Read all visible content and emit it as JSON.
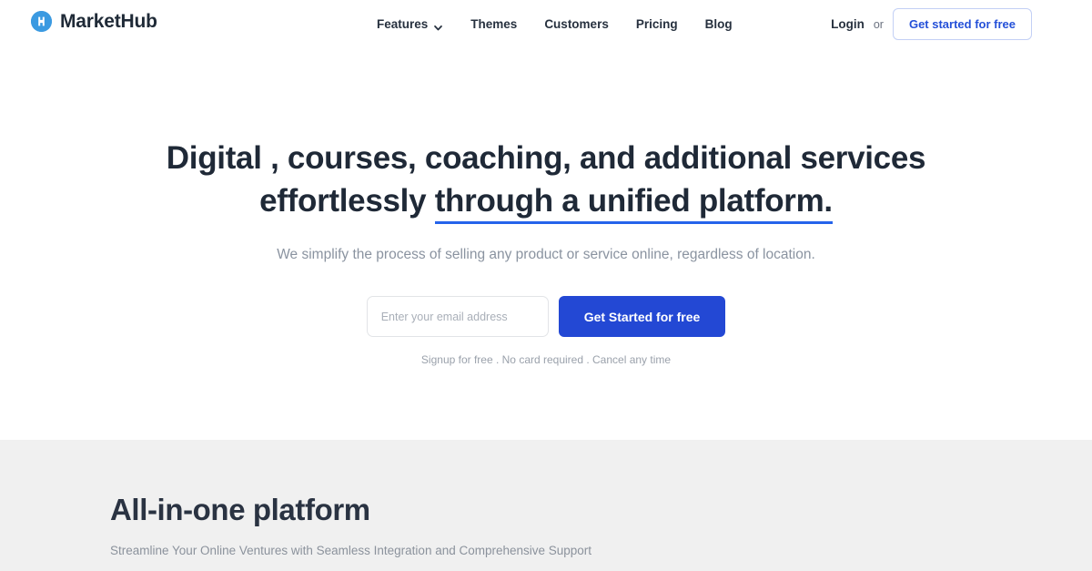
{
  "brand": {
    "name": "MarketHub",
    "mark_letter": "M",
    "mark_color": "#3b9ae1"
  },
  "nav": {
    "items": [
      {
        "label": "Features",
        "has_dropdown": true,
        "icon": "chevron-down-icon"
      },
      {
        "label": "Themes",
        "has_dropdown": false
      },
      {
        "label": "Customers",
        "has_dropdown": false
      },
      {
        "label": "Pricing",
        "has_dropdown": false
      },
      {
        "label": "Blog",
        "has_dropdown": false
      }
    ]
  },
  "header_actions": {
    "login_label": "Login",
    "separator": "or",
    "cta_label": "Get started for free",
    "cta_text_color": "#2450d8",
    "cta_border_color": "#c3d0f5"
  },
  "hero": {
    "title_line1": "Digital , courses, coaching, and additional services",
    "title_line2_plain": "effortlessly ",
    "title_line2_underlined": "through a unified platform.",
    "underline_color": "#2563eb",
    "subtitle": "We simplify the process of selling any product or service online, regardless of location.",
    "email_placeholder": "Enter your email address",
    "email_value": "",
    "cta_label": "Get Started for free",
    "cta_color": "#2348d4",
    "fineprint": "Signup for free .  No card required .  Cancel any time"
  },
  "features_section": {
    "title": "All-in-one platform",
    "subtitle": "Streamline Your Online Ventures with Seamless Integration and Comprehensive Support",
    "background_color": "#f0f0f0"
  }
}
